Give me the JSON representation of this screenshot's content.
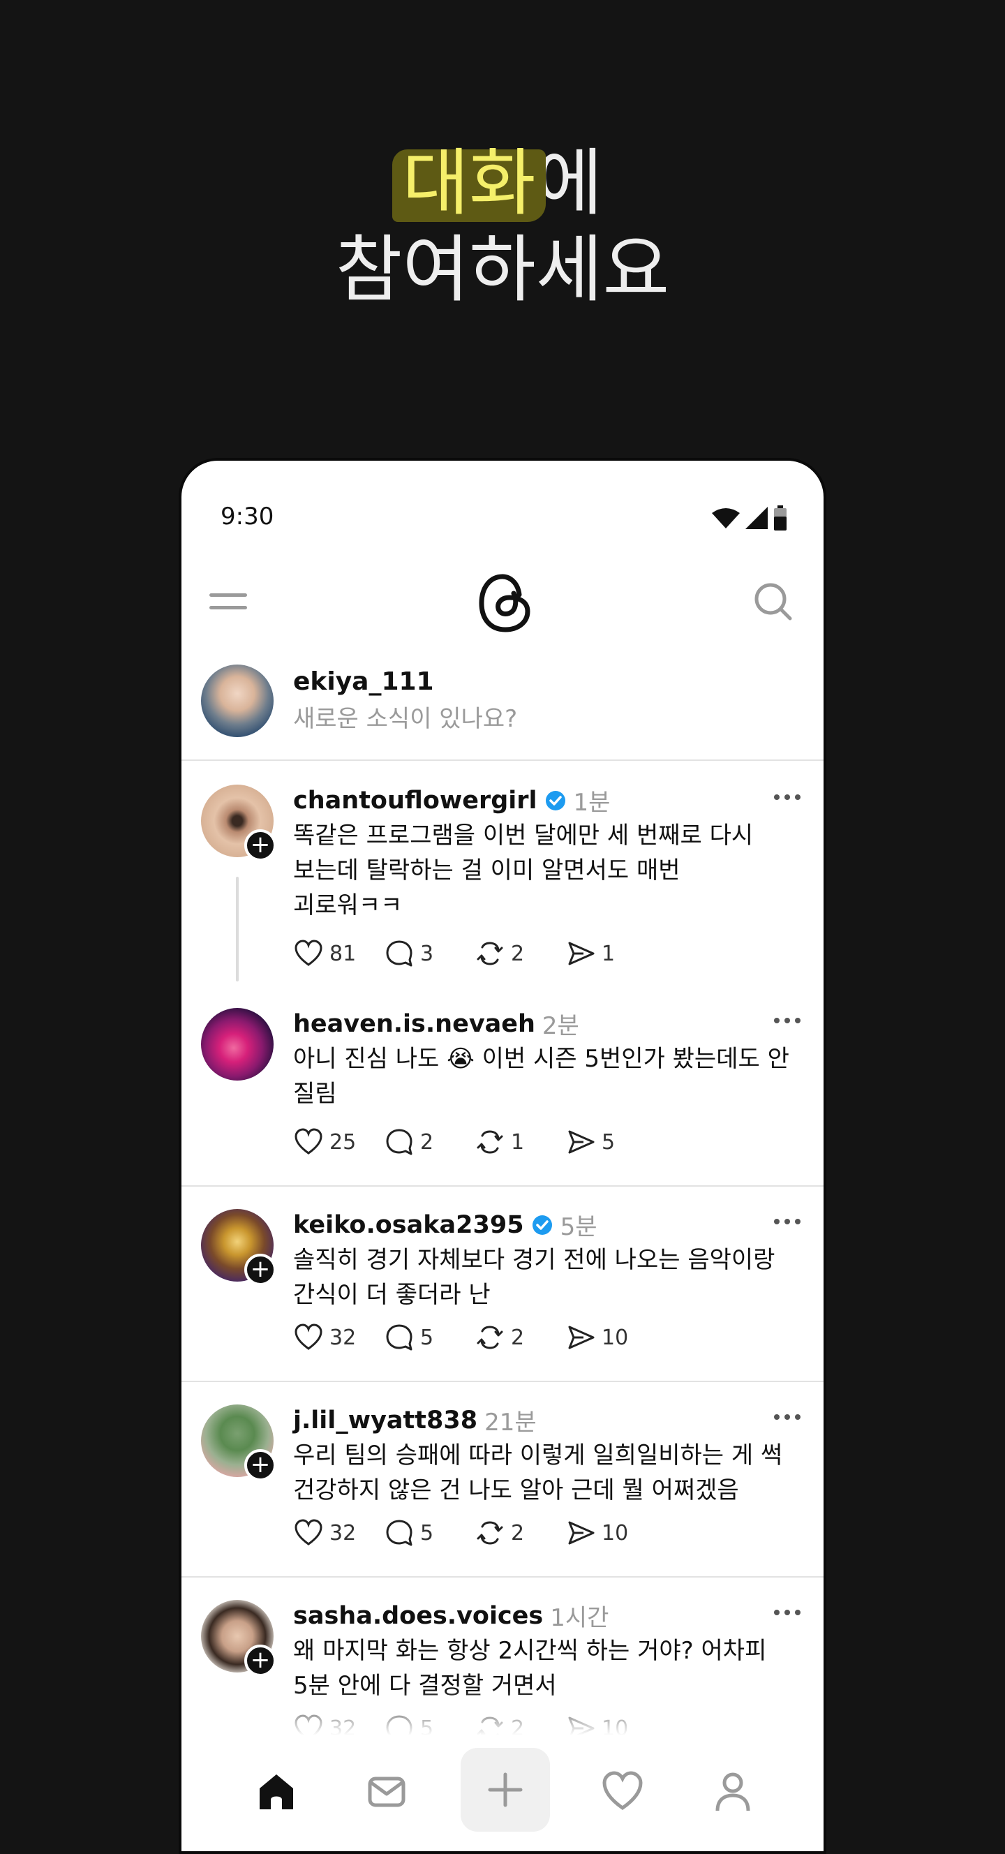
{
  "headline": {
    "highlight": "대화",
    "line1_rest": "에",
    "line2": "참여하세요"
  },
  "status_bar": {
    "time": "9:30"
  },
  "composer": {
    "username": "ekiya_111",
    "placeholder": "새로운 소식이 있나요?"
  },
  "posts": [
    {
      "username": "chantouflowergirl",
      "verified": true,
      "time": "1분",
      "text": "똑같은 프로그램을 이번 달에만 세 번째로 다시\n보는데 탈락하는 걸 이미 알면서도 매번\n괴로워ㅋㅋ",
      "likes": "81",
      "replies": "3",
      "reposts": "2",
      "shares": "1"
    },
    {
      "username": "heaven.is.nevaeh",
      "verified": false,
      "time": "2분",
      "text": "아니 진심 나도 😭 이번 시즌 5번인가 봤는데도 안\n질림",
      "likes": "25",
      "replies": "2",
      "reposts": "1",
      "shares": "5"
    },
    {
      "username": "keiko.osaka2395",
      "verified": true,
      "time": "5분",
      "text": "솔직히 경기 자체보다 경기 전에 나오는 음악이랑\n간식이 더 좋더라 난",
      "likes": "32",
      "replies": "5",
      "reposts": "2",
      "shares": "10"
    },
    {
      "username": "j.lil_wyatt838",
      "verified": false,
      "time": "21분",
      "text": "우리 팀의 승패에 따라 이렇게 일희일비하는 게 썩\n건강하지 않은 건 나도 알아 근데 뭘 어쩌겠음",
      "likes": "32",
      "replies": "5",
      "reposts": "2",
      "shares": "10"
    },
    {
      "username": "sasha.does.voices",
      "verified": false,
      "time": "1시간",
      "text": "왜 마지막 화는 항상 2시간씩 하는 거야? 어차피\n5분 안에 다 결정할 거면서",
      "likes": "32",
      "replies": "5",
      "reposts": "2",
      "shares": "10"
    }
  ],
  "icons": {
    "menu": "menu-icon",
    "logo": "threads-logo-icon",
    "search": "search-icon",
    "verified": "verified-badge-icon",
    "like": "heart-icon",
    "reply": "comment-icon",
    "repost": "repost-icon",
    "share": "send-icon",
    "nav": [
      "home-icon",
      "inbox-icon",
      "plus-icon",
      "heart-icon",
      "profile-icon"
    ]
  },
  "colors": {
    "page_background": "#141414",
    "highlight_text": "#f5ef6a",
    "highlight_marker": "#5e5a14",
    "verified_blue": "#1d9bf0",
    "muted_text": "#9a9a9a"
  }
}
